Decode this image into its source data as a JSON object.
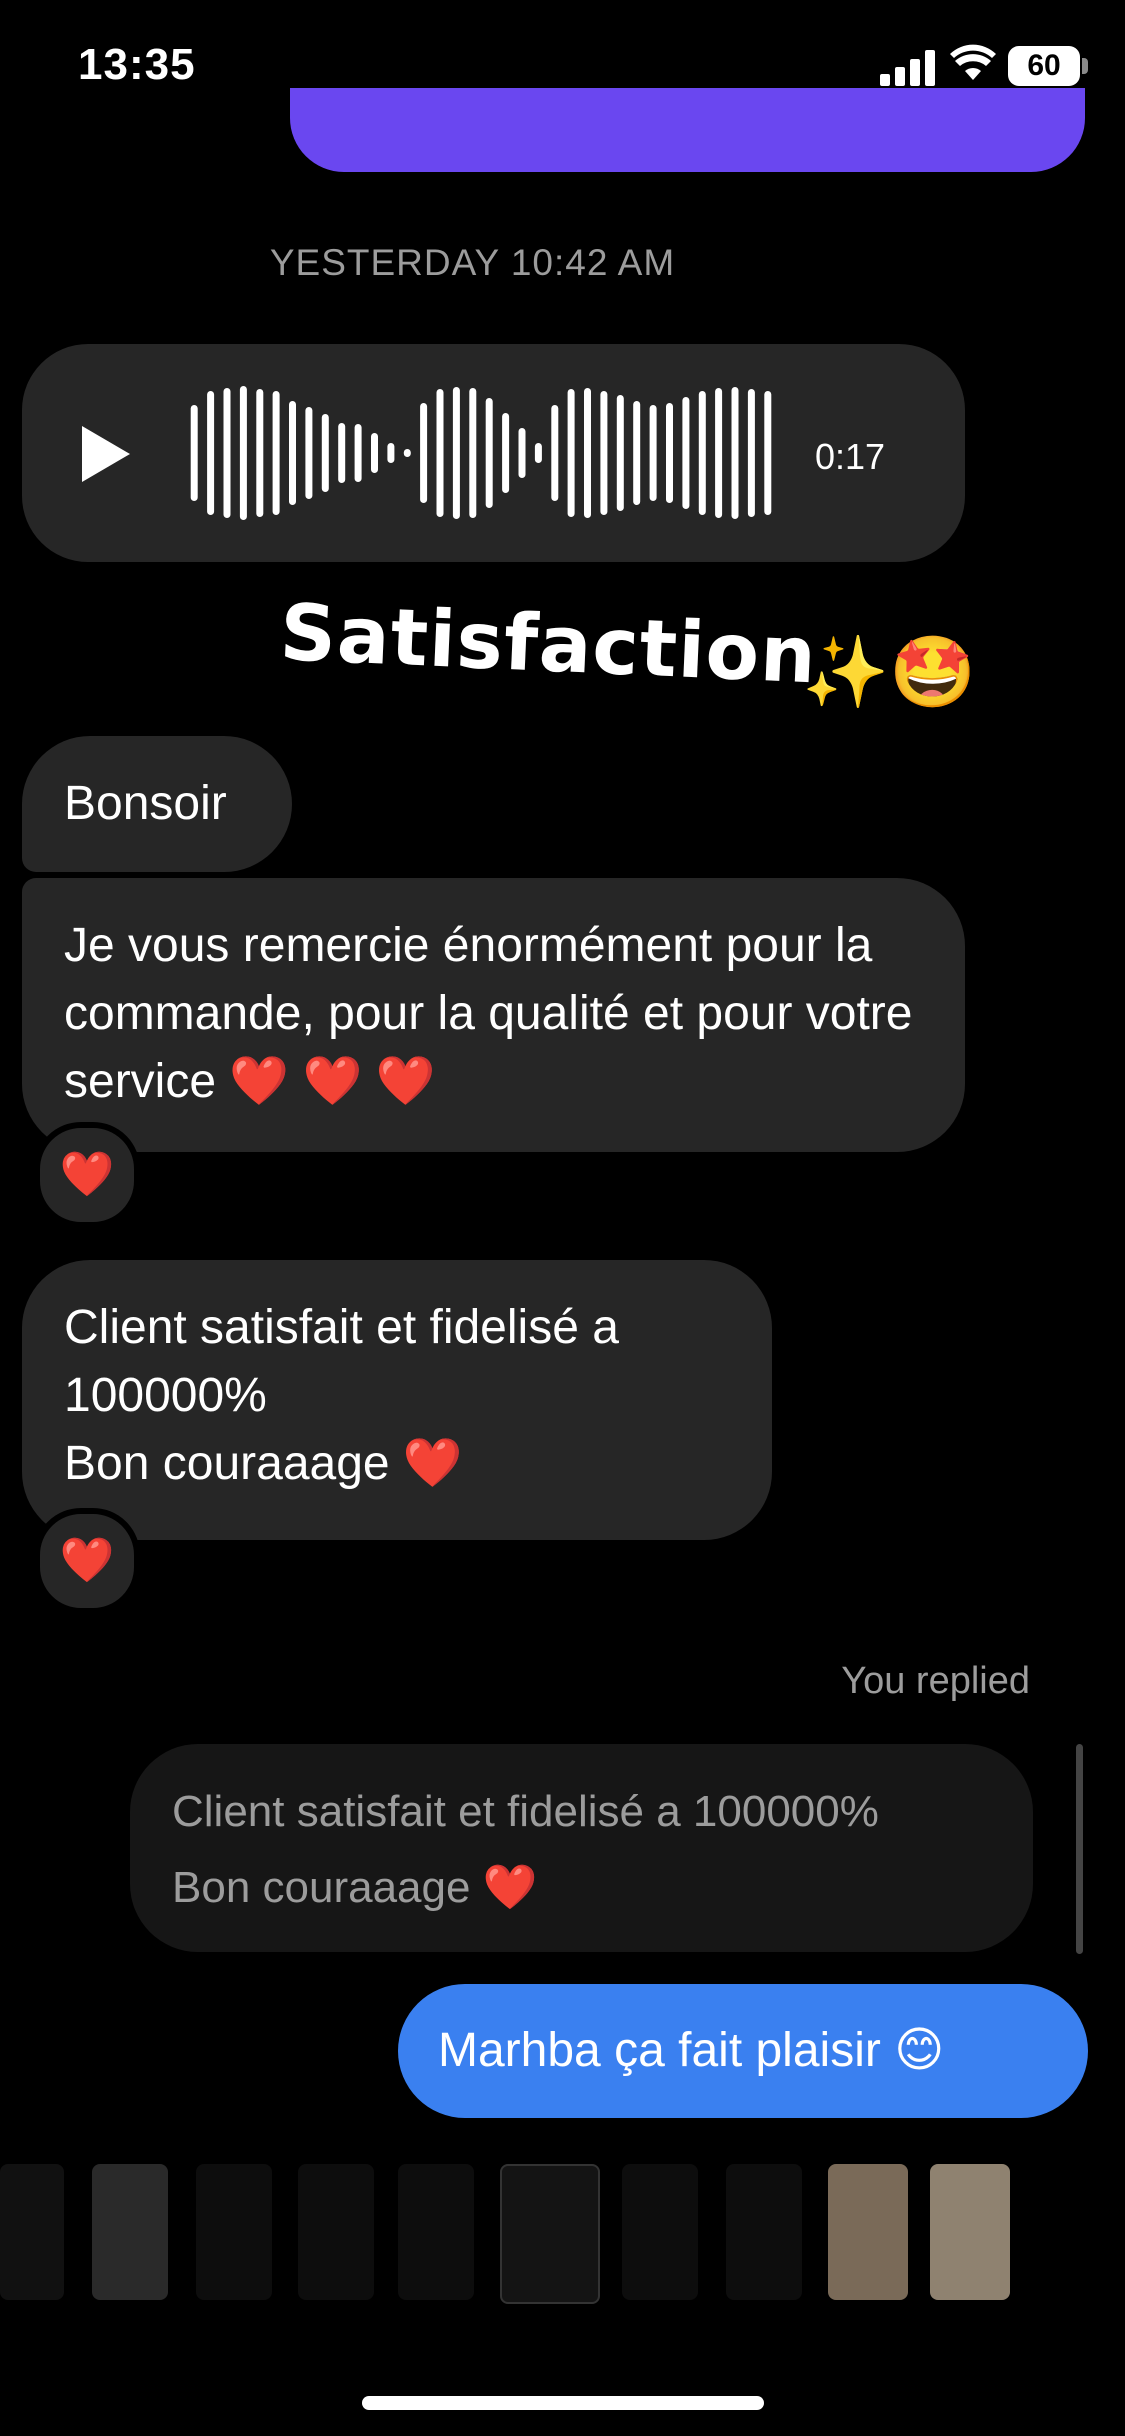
{
  "status_bar": {
    "time": "13:35",
    "battery": "60"
  },
  "timestamp": "YESTERDAY 10:42 AM",
  "voice_message": {
    "duration": "0:17"
  },
  "sticker": {
    "text": "Satisfaction",
    "emoji": "✨🤩"
  },
  "messages": [
    {
      "text": "Bonsoir"
    },
    {
      "text": "Je vous remercie énormément pour la commande, pour la qualité et pour votre service ❤️ ❤️ ❤️",
      "reaction": "❤️"
    },
    {
      "line1": "Client satisfait et fidelisé a 100000%",
      "line2": "Bon couraaage ❤️",
      "reaction": "❤️"
    }
  ],
  "reply_label": "You replied",
  "quoted": {
    "line1": "Client satisfait et fidelisé a 100000%",
    "line2": "Bon couraaage ❤️"
  },
  "outgoing": {
    "text": "Marhba ça fait plaisir 😊"
  },
  "colors": {
    "background": "#000000",
    "incoming_bubble": "#262626",
    "outgoing_bubble": "#3a80f0",
    "accent_purple": "#6a47f0"
  }
}
